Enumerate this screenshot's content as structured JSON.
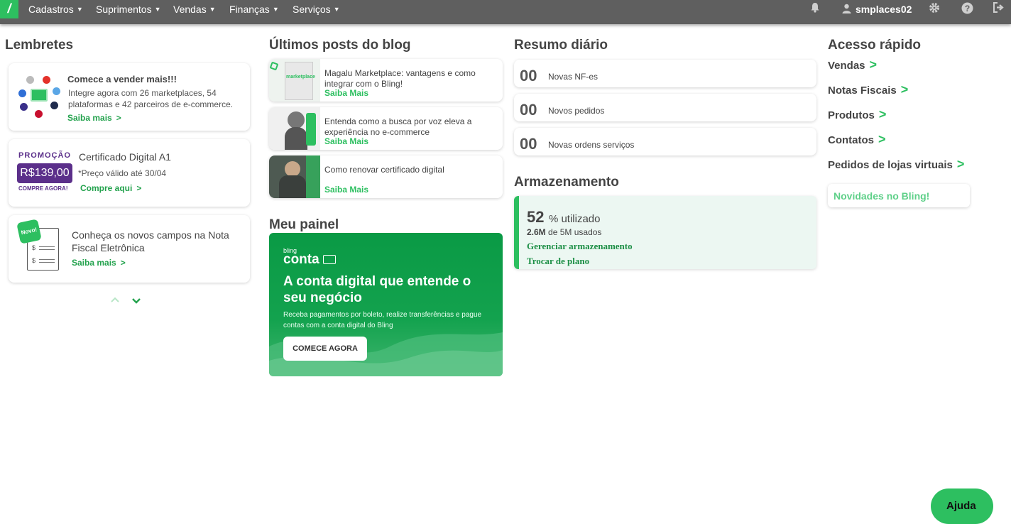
{
  "topbar": {
    "logo": "/",
    "menu": [
      "Cadastros",
      "Suprimentos",
      "Vendas",
      "Finanças",
      "Serviços"
    ],
    "username": "smplaces02",
    "icons": [
      "bell-icon",
      "user-icon",
      "gear-icon",
      "help-icon",
      "logout-icon"
    ]
  },
  "lembretes": {
    "title": "Lembretes",
    "items": [
      {
        "title": "Comece a vender mais!!!",
        "text": "Integre agora com 26 marketplaces, 54 plataformas e 42 parceiros de e-commerce.",
        "link": "Saiba mais"
      },
      {
        "promo_label": "PROMOÇÃO",
        "promo_price": "R$139,00",
        "promo_cta": "COMPRE AGORA!",
        "title": "Certificado Digital A1",
        "text": "*Preço válido até 30/04",
        "link": "Compre aqui"
      },
      {
        "badge": "Novo!",
        "title": "Conheça os novos campos na Nota Fiscal Eletrônica",
        "link": "Saiba mais"
      }
    ]
  },
  "blog": {
    "title": "Últimos posts do blog",
    "posts": [
      {
        "text": "Magalu Marketplace: vantagens e como integrar com o Bling!",
        "link": "Saiba Mais",
        "img_text": "marketplace"
      },
      {
        "text": "Entenda como a busca por voz eleva a experiência no e-commerce",
        "link": "Saiba Mais"
      },
      {
        "text": "Como renovar certificado digital",
        "link": "Saiba Mais"
      }
    ]
  },
  "painel": {
    "title": "Meu painel",
    "brand_small": "bling",
    "brand": "conta",
    "headline": "A conta digital que entende o seu negócio",
    "sub": "Receba pagamentos por boleto, realize transferências e pague contas com a conta digital do Bling",
    "button": "COMECE AGORA"
  },
  "resumo": {
    "title": "Resumo diário",
    "items": [
      {
        "num": "00",
        "label": "Novas NF-es"
      },
      {
        "num": "00",
        "label": "Novos pedidos"
      },
      {
        "num": "00",
        "label": "Novas ordens serviços"
      }
    ]
  },
  "armazenamento": {
    "title": "Armazenamento",
    "percent": "52",
    "percent_label": "% utilizado",
    "used_value": "2.6M",
    "used_text": "de 5M usados",
    "link1": "Gerenciar armazenamento",
    "link2": "Trocar de plano"
  },
  "acesso": {
    "title": "Acesso rápido",
    "items": [
      "Vendas",
      "Notas Fiscais",
      "Produtos",
      "Contatos",
      "Pedidos de lojas virtuais"
    ],
    "novidades": "Novidades no Bling!"
  },
  "help_button": "Ajuda",
  "colors": {
    "green": "#2dbf60",
    "topbar": "#5f5f5f",
    "purple": "#5b2f8a"
  }
}
